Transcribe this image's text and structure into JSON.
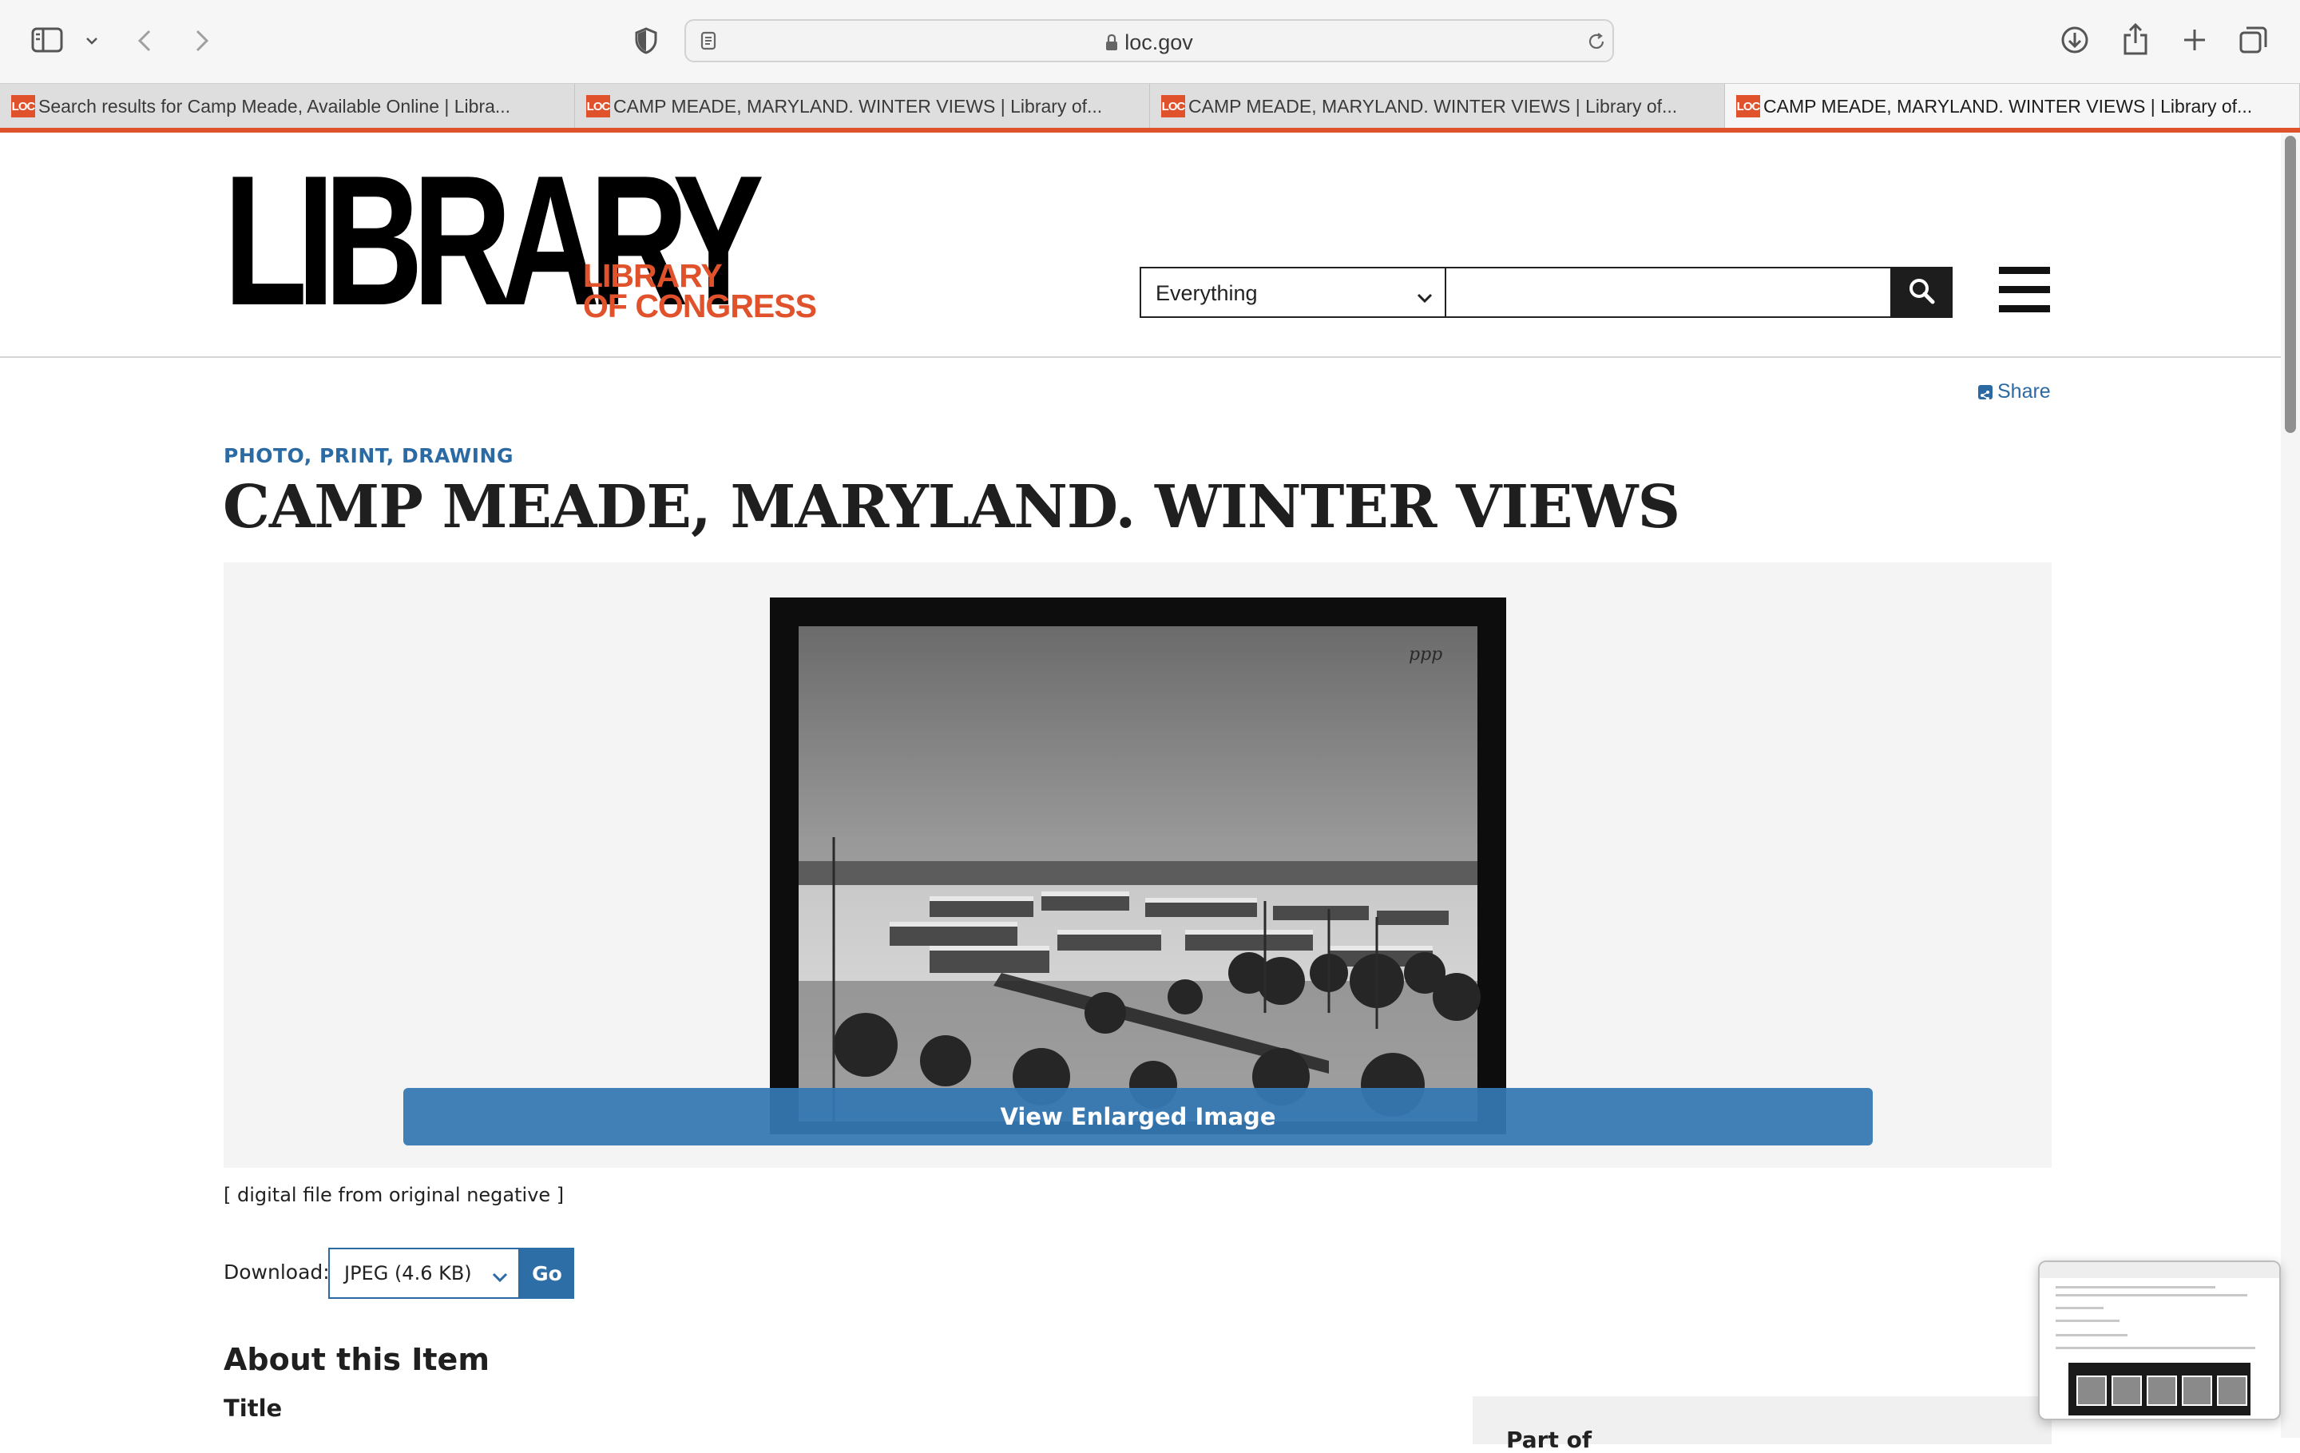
{
  "browser": {
    "address": "loc.gov",
    "tabs": [
      {
        "favicon": "LOC",
        "title": "Search results for Camp Meade, Available Online | Libra..."
      },
      {
        "favicon": "LOC",
        "title": "CAMP MEADE, MARYLAND. WINTER VIEWS | Library of..."
      },
      {
        "favicon": "LOC",
        "title": "CAMP MEADE, MARYLAND. WINTER VIEWS | Library of..."
      },
      {
        "favicon": "LOC",
        "title": "CAMP MEADE, MARYLAND. WINTER VIEWS | Library of..."
      }
    ],
    "active_tab_index": 3,
    "icons": [
      "sidebar-icon",
      "chevron-down-icon",
      "back-icon",
      "forward-icon",
      "shield-icon",
      "page-icon",
      "lock-icon",
      "reload-icon",
      "download-icon",
      "share-icon",
      "new-tab-icon",
      "tab-overview-icon"
    ]
  },
  "site": {
    "logo_big": "LIBRARY",
    "logo_sub_line1": "LIBRARY",
    "logo_sub_line2": "OF CONGRESS",
    "accent_color": "#e0522c",
    "link_color": "#2b6aa3",
    "search": {
      "scope_value": "Everything",
      "query_value": ""
    }
  },
  "item": {
    "share_label": "Share",
    "format": "PHOTO, PRINT, DRAWING",
    "title": "CAMP MEADE, MARYLAND. WINTER VIEWS",
    "view_button": "View Enlarged Image",
    "caption": "[ digital file from original negative ]",
    "download_label": "Download:",
    "download_option": "JPEG (4.6 KB)",
    "download_go": "Go",
    "about_heading": "About this Item",
    "title_label": "Title",
    "side_heading": "Part of"
  }
}
